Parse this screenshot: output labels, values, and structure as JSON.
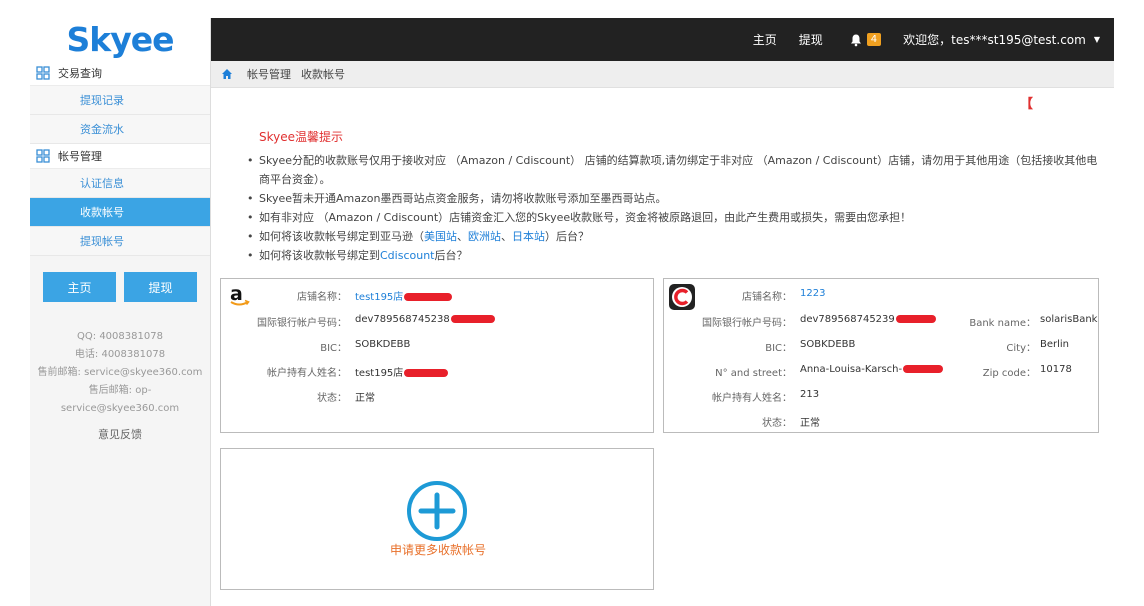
{
  "logo": {
    "text": "Skyee"
  },
  "topbar": {
    "home": "主页",
    "withdraw": "提现",
    "notification_count": "4",
    "welcome": "欢迎您，tes***st195@test.com"
  },
  "sidebar": {
    "groups": [
      {
        "label": "交易查询",
        "items": [
          "提现记录",
          "资金流水"
        ]
      },
      {
        "label": "帐号管理",
        "items": [
          "认证信息",
          "收款帐号",
          "提现帐号"
        ]
      }
    ],
    "active_item": "收款帐号",
    "buttons": {
      "home": "主页",
      "withdraw": "提现"
    },
    "contact": {
      "qq": "QQ: 4008381078",
      "phone": "电话: 4008381078",
      "presale": "售前邮箱: service@skyee360.com",
      "aftersale": "售后邮箱: op-service@skyee360.com"
    },
    "feedback": "意见反馈"
  },
  "breadcrumb": {
    "level1": "帐号管理",
    "level2": "收款帐号"
  },
  "main": {
    "bracket": "【",
    "notice": {
      "title": "Skyee温馨提示",
      "items": [
        "Skyee分配的收款账号仅用于接收对应 （Amazon / Cdiscount） 店铺的结算款项,请勿绑定于非对应 （Amazon / Cdiscount）店铺，请勿用于其他用途（包括接收其他电商平台资金）。",
        "Skyee暂未开通Amazon墨西哥站点资金服务，请勿将收款账号添加至墨西哥站点。",
        "如有非对应 （Amazon / Cdiscount）店铺资金汇入您的Skyee收款账号，资金将被原路退回，由此产生费用或损失，需要由您承担！"
      ],
      "item4_prefix": "如何将该收款帐号绑定到亚马逊（",
      "item4_link1": "美国站",
      "item4_sep1": "、",
      "item4_link2": "欧洲站",
      "item4_sep2": "、",
      "item4_link3": "日本站",
      "item4_suffix": "）后台？",
      "item5_prefix": "如何将该收款帐号绑定到",
      "item5_link": "Cdiscount",
      "item5_suffix": "后台？"
    },
    "card_amazon": {
      "logo": "a",
      "store_label": "店铺名称：",
      "store_value": "test195店",
      "iban_label": "国际银行帐户号码：",
      "iban_value": "dev789568745238",
      "bic_label": "BIC：",
      "bic_value": "SOBKDEBB",
      "holder_label": "帐户持有人姓名：",
      "holder_value": "test195店",
      "status_label": "状态：",
      "status_value": "正常"
    },
    "card_cdiscount": {
      "store_label": "店铺名称：",
      "store_value": "1223",
      "iban_label": "国际银行帐户号码：",
      "iban_value": "dev789568745239",
      "bic_label": "BIC：",
      "bic_value": "SOBKDEBB",
      "street_label": "N° and street：",
      "street_value": "Anna-Louisa-Karsch-",
      "holder_label": "帐户持有人姓名：",
      "holder_value": "213",
      "status_label": "状态：",
      "status_value": "正常",
      "bank_label": "Bank name：",
      "bank_value": "solarisBank",
      "city_label": "City：",
      "city_value": "Berlin",
      "zip_label": "Zip code：",
      "zip_value": "10178"
    },
    "add_card": {
      "label": "申请更多收款帐号"
    }
  }
}
